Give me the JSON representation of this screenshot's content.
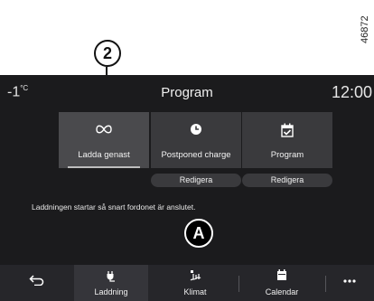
{
  "figure": {
    "reference_number": "46872",
    "callout_number": "2",
    "callout_letter": "A"
  },
  "header": {
    "outside_temp": "-1",
    "temp_unit": "°C",
    "title": "Program",
    "clock": "12:00"
  },
  "tiles": [
    {
      "icon": "infinity-icon",
      "label": "Ladda genast",
      "selected": true
    },
    {
      "icon": "clock-icon",
      "label": "Postponed charge",
      "selected": false
    },
    {
      "icon": "calendar-check-icon",
      "label": "Program",
      "selected": false
    }
  ],
  "edit_buttons": [
    "Redigera",
    "Redigera"
  ],
  "info_text": "Laddningen startar så snart fordonet är anslutet.",
  "bottom_nav": {
    "back": "back-arrow-icon",
    "items": [
      {
        "label": "Laddning",
        "icon": "charging-plug-icon",
        "active": true
      },
      {
        "label": "Klimat",
        "icon": "climate-icon",
        "active": false
      },
      {
        "label": "Calendar",
        "icon": "calendar-icon",
        "active": false
      }
    ],
    "more": "more-dots-icon"
  }
}
